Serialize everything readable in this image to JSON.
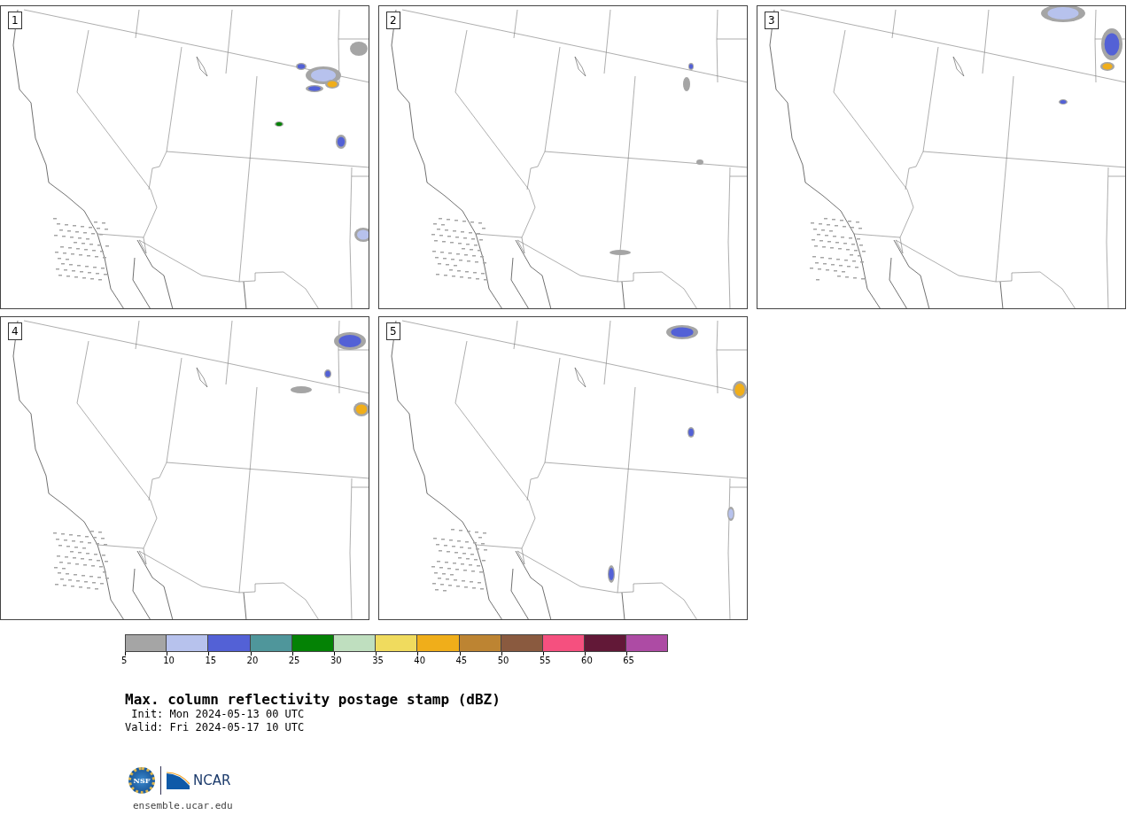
{
  "panels": [
    {
      "label": "1"
    },
    {
      "label": "2"
    },
    {
      "label": "3"
    },
    {
      "label": "4"
    },
    {
      "label": "5"
    }
  ],
  "colorbar": {
    "bins": [
      {
        "color": "#a5a5a5",
        "label": "5"
      },
      {
        "color": "#b7c2ed",
        "label": "10"
      },
      {
        "color": "#5361d6",
        "label": "15"
      },
      {
        "color": "#4f969b",
        "label": "20"
      },
      {
        "color": "#048205",
        "label": "25"
      },
      {
        "color": "#bfdfbf",
        "label": "30"
      },
      {
        "color": "#f0db5e",
        "label": "35"
      },
      {
        "color": "#f0ae1a",
        "label": "40"
      },
      {
        "color": "#bd8432",
        "label": "45"
      },
      {
        "color": "#8a5a3f",
        "label": "50"
      },
      {
        "color": "#f5507f",
        "label": "55"
      },
      {
        "color": "#621837",
        "label": "60"
      },
      {
        "color": "#ad4ba4",
        "label": "65"
      }
    ]
  },
  "title": "Max. column reflectivity postage stamp (dBZ)",
  "init": " Init: Mon 2024-05-13 00 UTC",
  "valid": "Valid: Fri 2024-05-17 10 UTC",
  "logo": {
    "left_mark": "NSF",
    "right_mark": "NCAR",
    "url": "ensemble.ucar.edu"
  }
}
